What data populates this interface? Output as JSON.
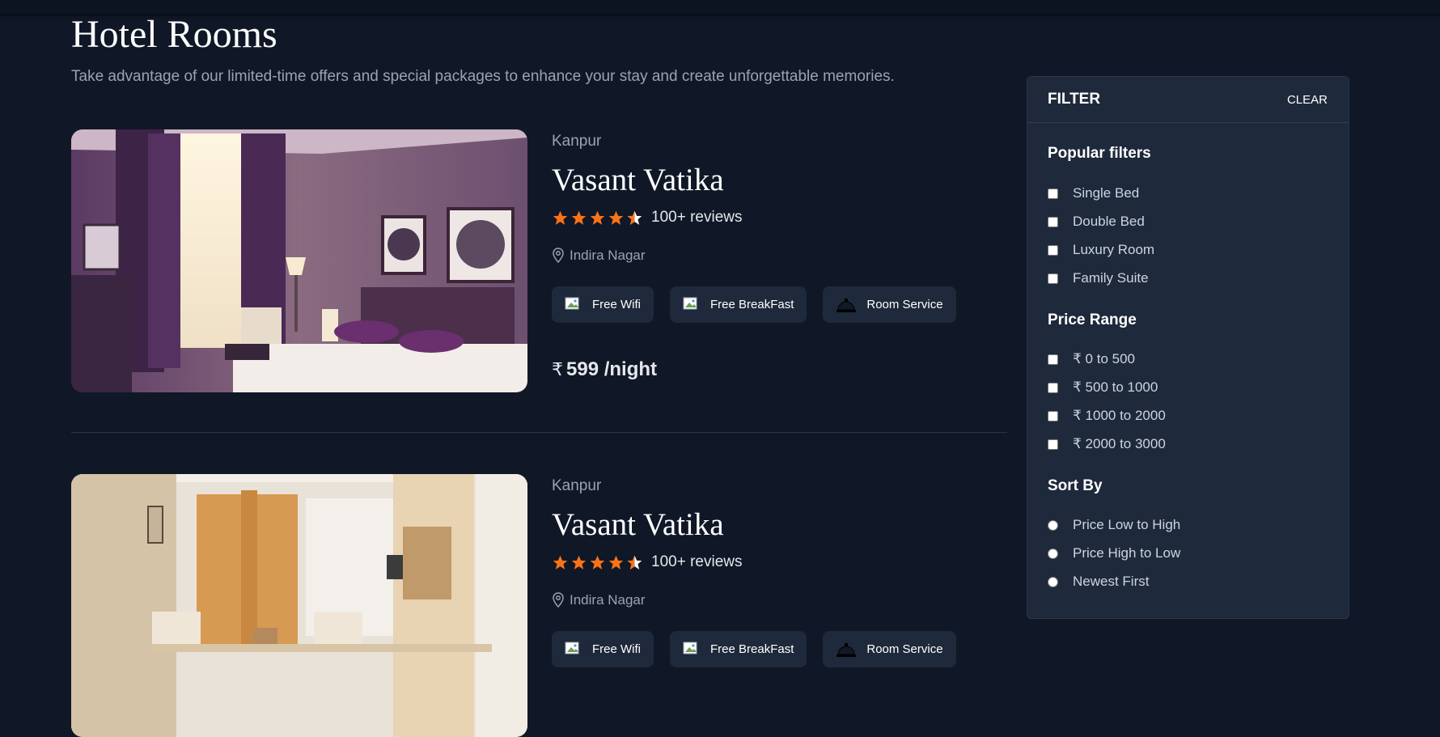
{
  "header": {
    "title": "Hotel Rooms",
    "subtitle": "Take advantage of our limited-time offers and special packages to enhance your stay and create unforgettable memories."
  },
  "rooms": [
    {
      "city": "Kanpur",
      "name": "Vasant Vatika",
      "rating": 4.5,
      "reviews": "100+ reviews",
      "location": "Indira Nagar",
      "amenities": [
        "Free Wifi",
        "Free BreakFast",
        "Room Service"
      ],
      "currency": "₹",
      "price": "599 /night"
    },
    {
      "city": "Kanpur",
      "name": "Vasant Vatika",
      "rating": 4.5,
      "reviews": "100+ reviews",
      "location": "Indira Nagar",
      "amenities": [
        "Free Wifi",
        "Free BreakFast",
        "Room Service"
      ]
    }
  ],
  "filter": {
    "title": "FILTER",
    "clear_label": "CLEAR",
    "popular": {
      "title": "Popular filters",
      "options": [
        "Single Bed",
        "Double Bed",
        "Luxury Room",
        "Family Suite"
      ]
    },
    "price_range": {
      "title": "Price Range",
      "options": [
        "₹ 0 to 500",
        "₹ 500 to 1000",
        "₹ 1000 to 2000",
        "₹ 2000 to 3000"
      ]
    },
    "sort_by": {
      "title": "Sort By",
      "options": [
        "Price Low to High",
        "Price High to Low",
        "Newest First"
      ]
    }
  },
  "colors": {
    "background": "#101827",
    "panel": "#1e293b",
    "star": "#f97316",
    "muted_text": "#9ca3af"
  }
}
